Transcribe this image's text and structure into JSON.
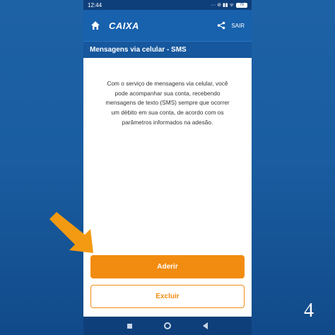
{
  "status_bar": {
    "time": "12:44",
    "icons": "··· ⊘ ▮▮ ᯤ",
    "battery": "79"
  },
  "header": {
    "logo": "CAIXA",
    "exit_label": "SAIR",
    "icons": [
      "home-icon",
      "share-icon"
    ]
  },
  "section": {
    "title": "Mensagens via celular - SMS"
  },
  "content": {
    "lines": [
      "Com o serviço de mensagens via celular, você",
      "pode acompanhar sua conta, recebendo",
      "mensagens de texto (SMS) sempre que ocorrer",
      "um débito em sua conta, de acordo com os",
      "parâmetros informados na adesão."
    ]
  },
  "actions": {
    "primary_label": "Aderir",
    "secondary_label": "Excluir"
  },
  "overlay": {
    "step_number": "4"
  },
  "colors": {
    "header_blue": "#1761ad",
    "accent_orange": "#f28c10",
    "background_blue": "#1a5ea1"
  }
}
